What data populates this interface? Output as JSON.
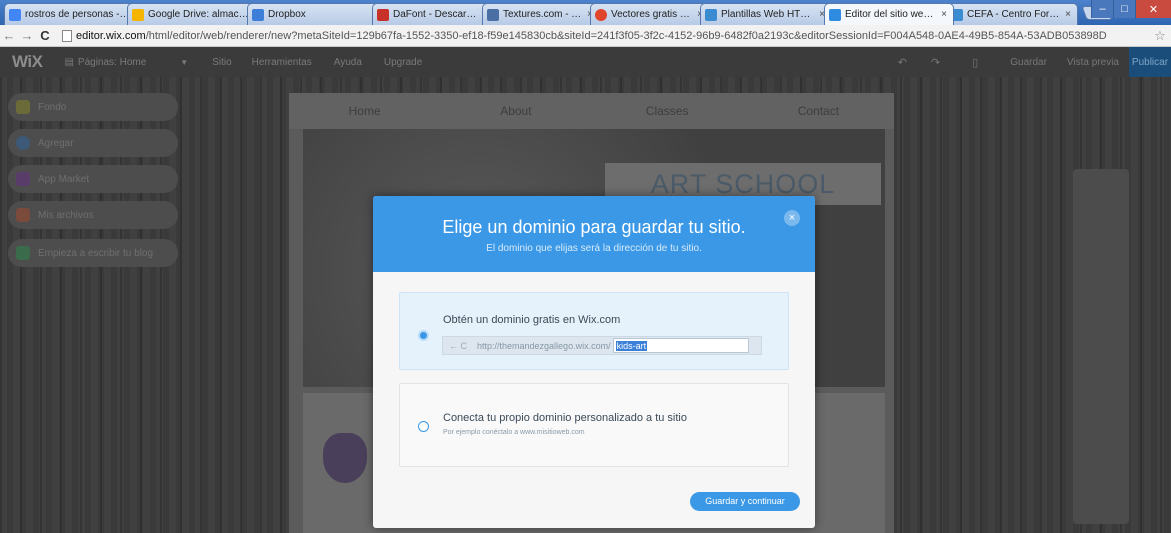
{
  "browser": {
    "tabs": [
      {
        "label": "rostros de personas - Bus",
        "color": "#4285f4"
      },
      {
        "label": "Google Drive: almacenam",
        "color": "#f4b400"
      },
      {
        "label": "Dropbox",
        "color": "#3d7fd8"
      },
      {
        "label": "DaFont - Descargar fuent",
        "color": "#c8312a"
      },
      {
        "label": "Textures.com - Textures f",
        "color": "#4a6fa5"
      },
      {
        "label": "Vectores gratis en Vector",
        "color": "#e0452b"
      },
      {
        "label": "Plantillas Web HTML de",
        "color": "#3a8bd0"
      },
      {
        "label": "Editor del sitio web Wix",
        "color": "#2f8be0"
      },
      {
        "label": "CEFA - Centro Formativo",
        "color": "#3a8bd0"
      }
    ],
    "close_glyph": "×",
    "url_host": "editor.wix.com",
    "url_rest": "/html/editor/web/renderer/new?metaSiteId=129b67fa-1552-3350-ef18-f59e145830cb&siteId=241f3f05-3f2c-4152-96b9-6482f0a2193c&editorSessionId=F004A548-0AE4-49B5-854A-53ADB053898D",
    "window_buttons": {
      "minimize": "–",
      "maximize": "□",
      "close": "✕"
    },
    "nav": {
      "back": "←",
      "forward": "→",
      "reload": "C",
      "star": "☆"
    }
  },
  "wix_topbar": {
    "logo": "WiX",
    "page_selector": "Páginas: Home",
    "menus": [
      "Sitio",
      "Herramientas",
      "Ayuda",
      "Upgrade"
    ],
    "undo_icon": "↶",
    "redo_icon": "↷",
    "mobile_icon": "▯",
    "save": "Guardar",
    "preview": "Vista previa",
    "publish": "Publicar"
  },
  "left_panel": [
    {
      "label": "Fondo",
      "icon_color": "#6b6b3a"
    },
    {
      "label": "Agregar",
      "icon_color": "#3c5a78"
    },
    {
      "label": "App Market",
      "icon_color": "#5a3c6b"
    },
    {
      "label": "Mis archivos",
      "icon_color": "#7a4a3a"
    },
    {
      "label": "Empieza a escribir tu blog",
      "icon_color": "#3a6b4a"
    }
  ],
  "site_preview": {
    "nav": [
      "Home",
      "About",
      "Classes",
      "Contact"
    ],
    "title": "ART SCHOOL"
  },
  "modal": {
    "title": "Elige un dominio para guardar tu sitio.",
    "subtitle": "El dominio que elijas será la dirección de tu sitio.",
    "close": "×",
    "option_free": {
      "label": "Obtén un dominio gratis en Wix.com",
      "url_prefix": "http://themandezgallego.wix.com/",
      "url_arrows": "← C",
      "site_name": "kids-art",
      "selected": true
    },
    "option_custom": {
      "label": "Conecta tu propio dominio personalizado a tu sitio",
      "hint": "Por ejemplo conéctalo a www.misitioweb.com",
      "selected": false
    },
    "save_button": "Guardar y continuar"
  }
}
